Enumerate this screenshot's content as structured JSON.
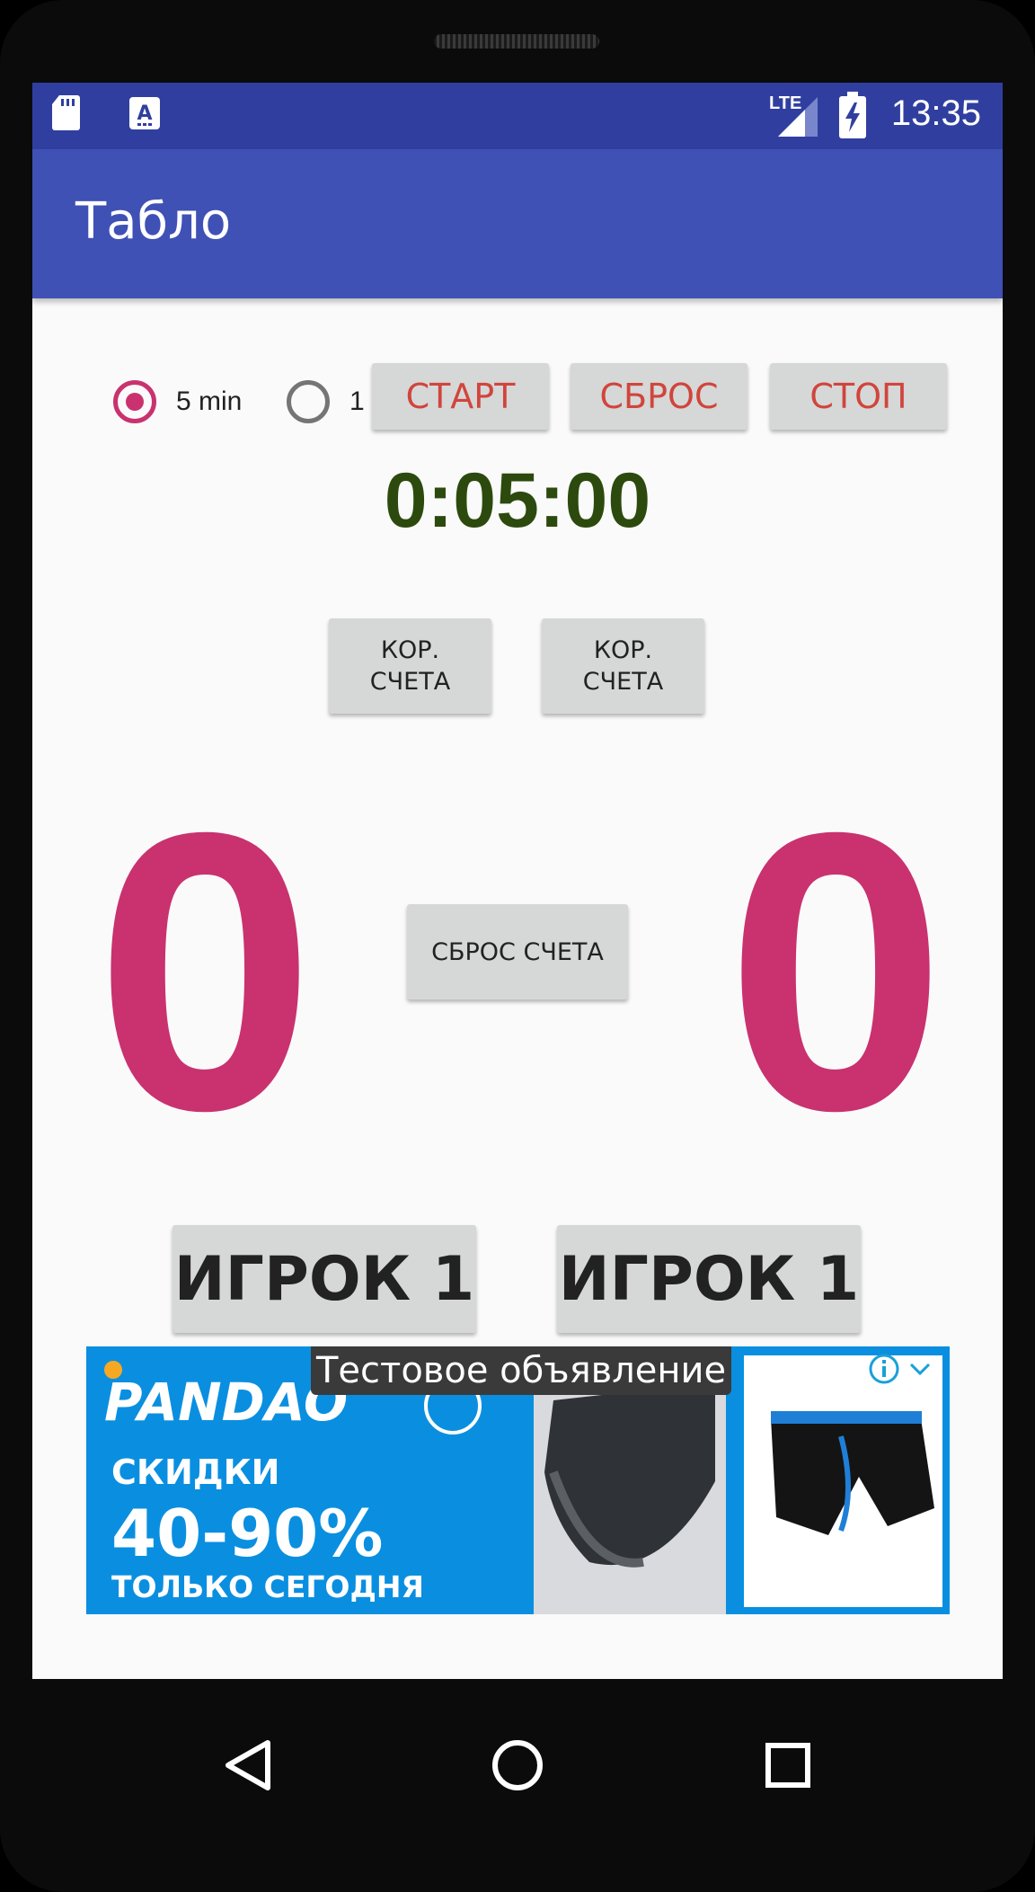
{
  "status_bar": {
    "network": "LTE",
    "time": "13:35"
  },
  "app_bar": {
    "title": "Табло"
  },
  "timer_options": [
    {
      "label": "5 min",
      "selected": true
    },
    {
      "label": "1",
      "selected": false
    }
  ],
  "controls": {
    "start": "СТАРТ",
    "reset": "СБРОС",
    "stop": "СТОП"
  },
  "timer": {
    "value": "0:05:00"
  },
  "score_correct": {
    "left": "КОР.\nСЧЕТА",
    "right": "КОР.\nСЧЕТА"
  },
  "score": {
    "left": "0",
    "right": "0",
    "reset_label": "СБРОС СЧЕТА"
  },
  "players": {
    "left": "ИГРОК 1",
    "right": "ИГРОК 1"
  },
  "ad": {
    "test_label": "Тестовое объявление",
    "brand": "PANDAO",
    "line1": "СКИДКИ",
    "line2": "40-90%",
    "line3": "ТОЛЬКО СЕГОДНЯ"
  },
  "colors": {
    "accent": "#c9326e",
    "primary": "#3f51b5",
    "primary_dark": "#303f9f",
    "timer": "#2d4a0e",
    "button_text_red": "#d0453c"
  }
}
